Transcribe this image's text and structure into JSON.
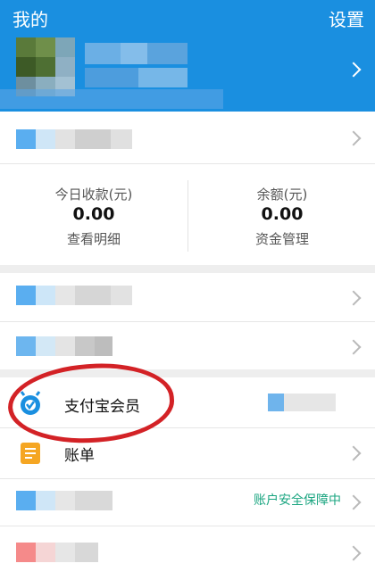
{
  "header": {
    "title": "我的",
    "settings_label": "设置"
  },
  "stats": {
    "today_label": "今日收款(元)",
    "today_value": "0.00",
    "today_link": "查看明细",
    "balance_label": "余额(元)",
    "balance_value": "0.00",
    "balance_link": "资金管理"
  },
  "menu": {
    "member_label": "支付宝会员",
    "bill_label": "账单",
    "security_status": "账户安全保障中"
  },
  "colors": {
    "header_bg": "#1a8fe0",
    "security_green": "#1aa580",
    "annotation_red": "#d32226",
    "bill_orange": "#f5a623"
  }
}
